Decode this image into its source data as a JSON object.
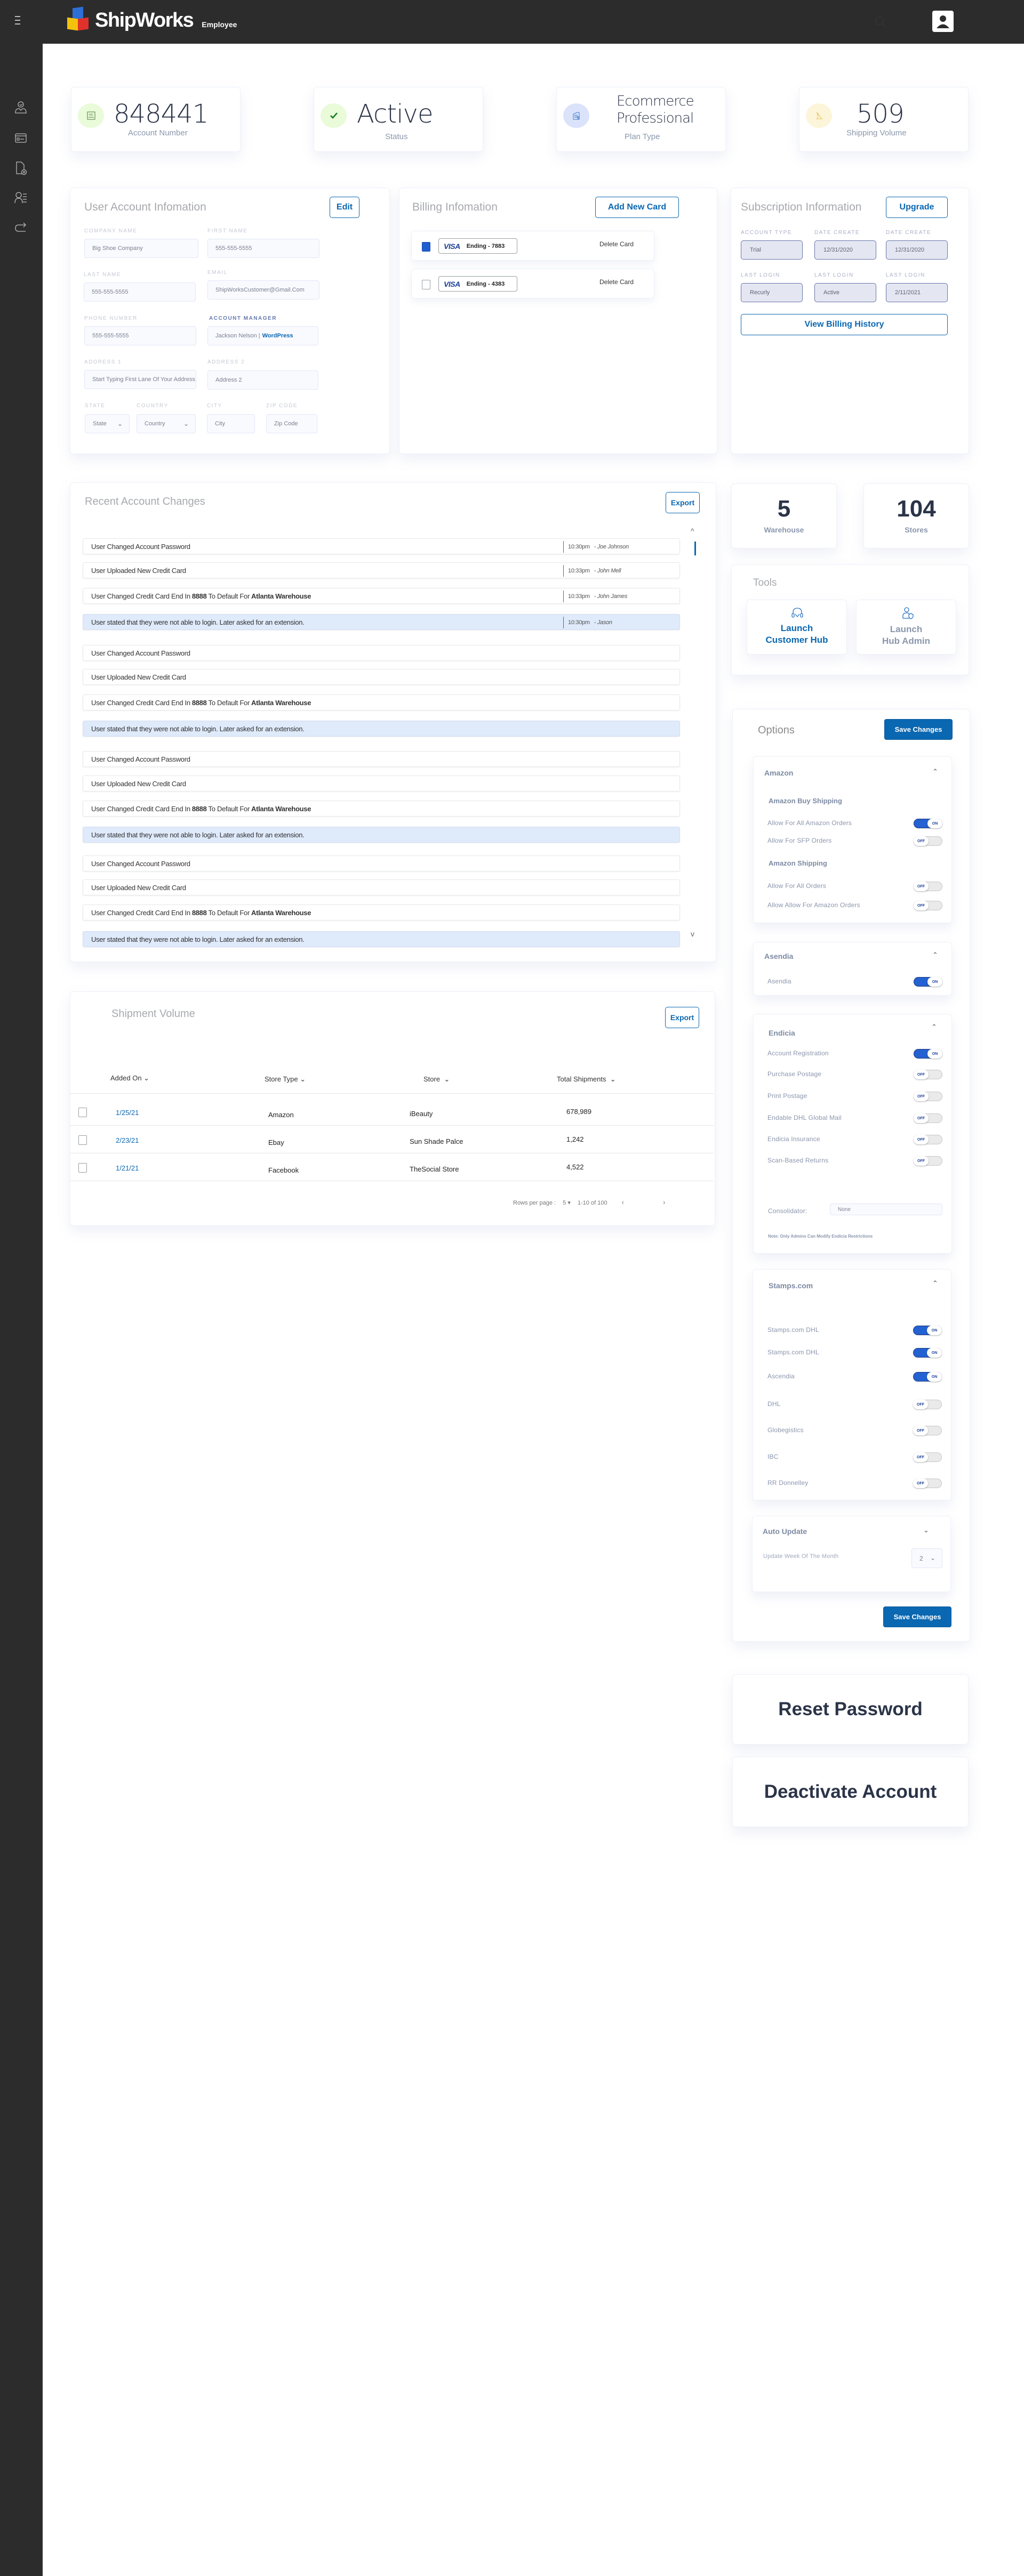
{
  "header": {
    "brand": "ShipWorks",
    "brand_sub": "Employee",
    "icons": [
      "menu-icon",
      "search-icon",
      "user-avatar-icon"
    ]
  },
  "sidebar": {
    "items": [
      {
        "icon": "user-check-icon",
        "label": "Account"
      },
      {
        "icon": "credit-card-icon",
        "label": "Billing"
      },
      {
        "icon": "document-cancel-icon",
        "label": "Subscriptions"
      },
      {
        "icon": "user-list-icon",
        "label": "Users"
      },
      {
        "icon": "redirect-icon",
        "label": "Redirect"
      }
    ]
  },
  "stats": [
    {
      "value": "848441",
      "label": "Account Number",
      "icon": "id-card-icon",
      "color": "#e9fbd9"
    },
    {
      "value": "Active",
      "label": "Status",
      "icon": "check-icon",
      "color": "#e9fbd9"
    },
    {
      "value_line1": "Ecommerce",
      "value_line2": "Professional",
      "label": "Plan Type",
      "icon": "building-icon",
      "color": "#dbe3fb"
    },
    {
      "value": "509",
      "label": "Shipping Volume",
      "icon": "crane-icon",
      "color": "#fdf5d9"
    }
  ],
  "user_account": {
    "title": "User Account Infomation",
    "edit_label": "Edit",
    "fields": {
      "company_name": {
        "label": "Company Name",
        "value": "Big Shoe Company"
      },
      "first_name": {
        "label": "First Name",
        "value": "555-555-5555"
      },
      "last_name": {
        "label": "Last Name",
        "value": "555-555-5555"
      },
      "email": {
        "label": "Email",
        "value": "ShipWorksCustomer@Gmail.Com"
      },
      "phone": {
        "label": "Phone Number",
        "value": "555-555-5555"
      },
      "account_manager": {
        "label": "Account Manager",
        "value": "Jackson Nelson |",
        "link": "WordPress"
      },
      "address1": {
        "label": "Address 1",
        "placeholder": "Start Typing First Lane Of Your Address"
      },
      "address2": {
        "label": "Address 2",
        "placeholder": "Address 2"
      },
      "state": {
        "label": "State",
        "value": "State"
      },
      "country": {
        "label": "Country",
        "value": "Country"
      },
      "city": {
        "label": "City",
        "placeholder": "City"
      },
      "zip": {
        "label": "Zip Code",
        "placeholder": "Zip Code"
      }
    }
  },
  "billing": {
    "title": "Billing Infomation",
    "add_label": "Add New Card",
    "cards": [
      {
        "brand": "VISA",
        "ending": "Ending - 7883",
        "selected": true,
        "delete_label": "Delete Card"
      },
      {
        "brand": "VISA",
        "ending": "Ending - 4383",
        "selected": false,
        "delete_label": "Delete Card"
      }
    ]
  },
  "subscription": {
    "title": "Subscription Information",
    "upgrade_label": "Upgrade",
    "fields": [
      {
        "label": "Account Type",
        "value": "Trial"
      },
      {
        "label": "Date Create",
        "value": "12/31/2020"
      },
      {
        "label": "Date Create",
        "value": "12/31/2020"
      },
      {
        "label": "Last Login",
        "value": "Recurly"
      },
      {
        "label": "Last Login",
        "value": "Active"
      },
      {
        "label": "Last Login",
        "value": "2/11/2021"
      }
    ],
    "history_label": "View Billing History"
  },
  "changes": {
    "title": "Recent Account Changes",
    "export_label": "Export",
    "rows": [
      {
        "type": "text",
        "text": "User Changed Account Password",
        "time": "10:30pm",
        "who": "- Joe Johnson"
      },
      {
        "type": "text",
        "text": "User Uploaded New Credit Card",
        "time": "10:33pm",
        "who": "- John Mell"
      },
      {
        "type": "card",
        "pre": "User Changed Credit Card End In",
        "num": "8888",
        "mid": "To Default For",
        "place": "Atlanta Warehouse",
        "time": "10:33pm",
        "who": "- John James"
      },
      {
        "type": "note",
        "text": "User stated that they were not able to login. Later asked for an extension.",
        "time": "10:30pm",
        "who": "- Jason"
      },
      {
        "type": "text",
        "text": "User Changed Account Password"
      },
      {
        "type": "text",
        "text": "User Uploaded New Credit Card"
      },
      {
        "type": "card",
        "pre": "User Changed Credit Card End In",
        "num": "8888",
        "mid": "To Default For",
        "place": "Atlanta Warehouse"
      },
      {
        "type": "note",
        "text": "User stated that they were not able to login. Later asked for an extension."
      },
      {
        "type": "text",
        "text": "User Changed Account Password"
      },
      {
        "type": "text",
        "text": "User Uploaded New Credit Card"
      },
      {
        "type": "card",
        "pre": "User Changed Credit Card End In",
        "num": "8888",
        "mid": "To Default For",
        "place": "Atlanta Warehouse"
      },
      {
        "type": "note",
        "text": "User stated that they were not able to login. Later asked for an extension."
      },
      {
        "type": "text",
        "text": "User Changed Account Password"
      },
      {
        "type": "text",
        "text": "User Uploaded New Credit Card"
      },
      {
        "type": "card",
        "pre": "User Changed Credit Card End In",
        "num": "8888",
        "mid": "To Default For",
        "place": "Atlanta Warehouse"
      },
      {
        "type": "note",
        "text": "User stated that they were not able to login. Later asked for an extension."
      }
    ]
  },
  "shipments": {
    "title": "Shipment Volume",
    "export_label": "Export",
    "columns": [
      "Added On",
      "Store Type",
      "Store",
      "Total Shipments"
    ],
    "rows": [
      {
        "added": "1/25/21",
        "type": "Amazon",
        "store": "iBeauty",
        "total": "678,989"
      },
      {
        "added": "2/23/21",
        "type": "Ebay",
        "store": "Sun Shade Palce",
        "total": "1,242"
      },
      {
        "added": "1/21/21",
        "type": "Facebook",
        "store": "TheSocial Store",
        "total": "4,522"
      }
    ],
    "pagination": {
      "rows_label": "Rows per page :",
      "rows_value": "5",
      "range": "1-10 of 100"
    }
  },
  "counts": [
    {
      "value": "5",
      "label": "Warehouse"
    },
    {
      "value": "104",
      "label": "Stores"
    }
  ],
  "tools": {
    "title": "Tools",
    "items": [
      {
        "line1": "Launch",
        "line2": "Customer Hub",
        "icon": "headset-icon",
        "active": true
      },
      {
        "line1": "Launch",
        "line2": "Hub Admin",
        "icon": "user-shield-icon",
        "active": false
      }
    ]
  },
  "options": {
    "title": "Options",
    "save_label": "Save Changes",
    "amazon": {
      "title": "Amazon",
      "groups": [
        {
          "title": "Amazon Buy Shipping",
          "items": [
            {
              "label": "Allow For All Amazon Orders",
              "on": true
            },
            {
              "label": "Allow For SFP Orders",
              "on": false
            }
          ]
        },
        {
          "title": "Amazon Shipping",
          "items": [
            {
              "label": "Allow For All Orders",
              "on": false
            },
            {
              "label": "Allow Allow For Amazon Orders",
              "on": false
            }
          ]
        }
      ]
    },
    "asendia": {
      "title": "Asendia",
      "items": [
        {
          "label": "Asendia",
          "on": true
        }
      ]
    },
    "endicia": {
      "title": "Endicia",
      "items": [
        {
          "label": "Account Registration",
          "on": true
        },
        {
          "label": "Purchase Postage",
          "on": false
        },
        {
          "label": "Print Postage",
          "on": false
        },
        {
          "label": "Endable DHL Global Mail",
          "on": false
        },
        {
          "label": "Endicia Insurance",
          "on": false
        },
        {
          "label": "Scan-Based Returns",
          "on": false
        }
      ],
      "consolidator_label": "Consolidator:",
      "consolidator_value": "None",
      "note": "Note: Only Admins Can Modify Endicia Restrictions"
    },
    "stamps": {
      "title": "Stamps.com",
      "items": [
        {
          "label": "Stamps.com DHL",
          "on": true
        },
        {
          "label": "Stamps.com DHL",
          "on": true
        },
        {
          "label": "Ascendia",
          "on": true
        },
        {
          "label": "DHL",
          "on": false
        },
        {
          "label": "Globegistics",
          "on": false
        },
        {
          "label": "IBC",
          "on": false
        },
        {
          "label": "RR Donnelley",
          "on": false
        }
      ]
    },
    "auto_update": {
      "title": "Auto Update",
      "label": "Update Week Of The Month",
      "value": "2"
    },
    "toggle_on": "ON",
    "toggle_off": "OFF"
  },
  "actions": {
    "reset": "Reset Password",
    "deactivate": "Deactivate Account"
  },
  "colors": {
    "accent": "#0a67b1",
    "toggle_on": "#2461d1",
    "topbar": "#2c2c2c",
    "note_bg": "#dfeafb"
  }
}
